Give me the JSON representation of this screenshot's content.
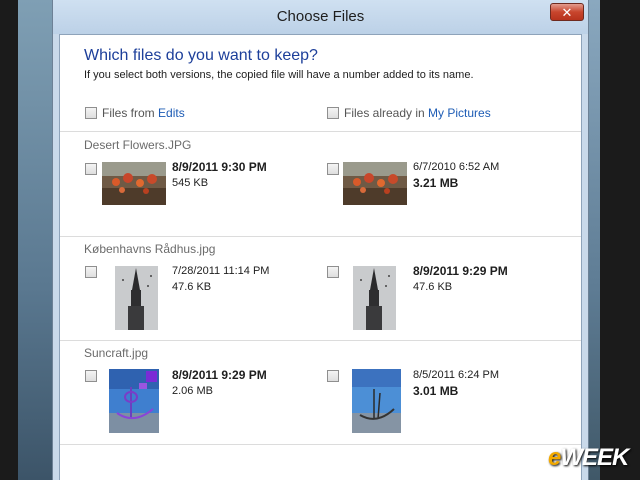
{
  "window": {
    "title": "Choose Files"
  },
  "dialog": {
    "heading": "Which files do you want to keep?",
    "subtext": "If you select both versions, the copied file will have a number added to its name.",
    "source_header": {
      "prefix": "Files from ",
      "link": "Edits"
    },
    "dest_header": {
      "prefix": "Files already in ",
      "link": "My Pictures"
    }
  },
  "files": [
    {
      "name": "Desert Flowers.JPG",
      "left": {
        "date": "8/9/2011 9:30 PM",
        "size": "545 KB",
        "thumb": "desert-flowers"
      },
      "right": {
        "date": "6/7/2010 6:52 AM",
        "size": "3.21 MB",
        "thumb": "desert-flowers"
      }
    },
    {
      "name": "Københavns Rådhus.jpg",
      "left": {
        "date": "7/28/2011 11:14 PM",
        "size": "47.6 KB",
        "thumb": "radhus-tower"
      },
      "right": {
        "date": "8/9/2011 9:29 PM",
        "size": "47.6 KB",
        "thumb": "radhus-tower"
      }
    },
    {
      "name": "Suncraft.jpg",
      "left": {
        "date": "8/9/2011 9:29 PM",
        "size": "2.06 MB",
        "thumb": "suncraft-edited"
      },
      "right": {
        "date": "8/5/2011 6:24 PM",
        "size": "3.01 MB",
        "thumb": "suncraft"
      }
    }
  ],
  "logo": {
    "e": "e",
    "rest": "WEEK"
  }
}
